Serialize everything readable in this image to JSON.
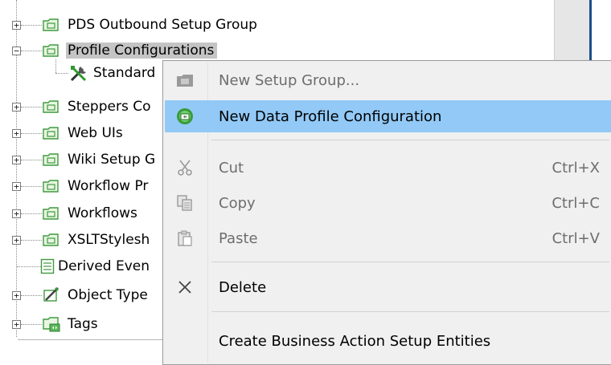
{
  "tree": {
    "items": [
      {
        "label": "PDS Outbound Setup Group",
        "icon": "folder-icon"
      },
      {
        "label": "Profile Configurations",
        "icon": "folder-icon",
        "selected": true
      },
      {
        "label": "Standard",
        "icon": "tools-icon"
      },
      {
        "label": "Steppers Co",
        "icon": "folder-icon"
      },
      {
        "label": "Web UIs",
        "icon": "folder-icon"
      },
      {
        "label": "Wiki Setup G",
        "icon": "folder-icon"
      },
      {
        "label": "Workflow Pr",
        "icon": "folder-icon"
      },
      {
        "label": "Workflows",
        "icon": "folder-icon"
      },
      {
        "label": "XSLTStylesh",
        "icon": "folder-icon"
      },
      {
        "label": "Derived Even",
        "icon": "document-icon"
      },
      {
        "label": "Object Type",
        "icon": "object-type-icon"
      },
      {
        "label": "Tags",
        "icon": "tags-folder-icon"
      }
    ]
  },
  "context_menu": {
    "items": [
      {
        "label": "New Setup Group...",
        "shortcut": "",
        "icon": "folder-camera-icon",
        "disabled": true
      },
      {
        "label": "New Data Profile Configuration",
        "shortcut": "",
        "icon": "data-profile-icon",
        "disabled": false,
        "highlighted": true
      },
      {
        "label": "Cut",
        "shortcut": "Ctrl+X",
        "icon": "scissors-icon",
        "disabled": true
      },
      {
        "label": "Copy",
        "shortcut": "Ctrl+C",
        "icon": "copy-icon",
        "disabled": true
      },
      {
        "label": "Paste",
        "shortcut": "Ctrl+V",
        "icon": "paste-icon",
        "disabled": true
      },
      {
        "label": "Delete",
        "shortcut": "",
        "icon": "delete-x-icon",
        "disabled": false
      },
      {
        "label": "Create Business Action Setup Entities",
        "shortcut": "",
        "icon": "",
        "disabled": false
      }
    ]
  },
  "colors": {
    "menu_highlight": "#92c9f6",
    "selection": "#c4c4c4",
    "folder_green": "#5bb85b",
    "scroll_accent": "#1d4f86"
  }
}
